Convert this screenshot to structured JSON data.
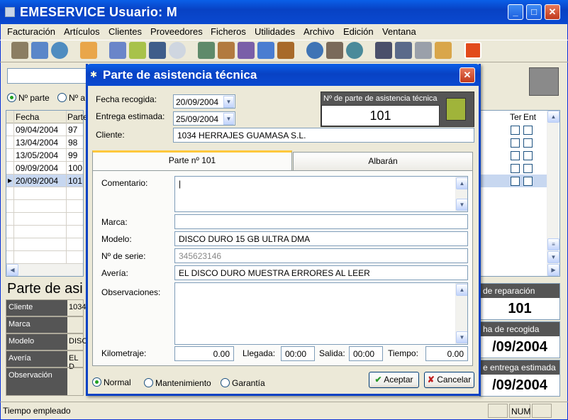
{
  "app": {
    "title": "EMESERVICE Usuario: M"
  },
  "menu": [
    "Facturación",
    "Artículos",
    "Clientes",
    "Proveedores",
    "Ficheros",
    "Utilidades",
    "Archivo",
    "Edición",
    "Ventana"
  ],
  "toolbar_icons": [
    "shelf-icon",
    "globe-icon",
    "globe2-icon",
    "home-icon",
    "users-icon",
    "puzzle-icon",
    "calculator-icon",
    "clock-icon",
    "register-icon",
    "people-icon",
    "people2-icon",
    "network-icon",
    "briefcase-icon",
    "globe3-icon",
    "box-icon",
    "globe4-icon",
    "scanner-icon",
    "book-icon",
    "printer-icon",
    "mail-icon",
    "power-icon"
  ],
  "background": {
    "radio_nparte": "Nº parte",
    "radio_na": "Nº a",
    "grid_headers": [
      "Fecha",
      "Parte"
    ],
    "right_headers": [
      "Ter",
      "Ent"
    ],
    "rows": [
      {
        "fecha": "09/04/2004",
        "parte": "97"
      },
      {
        "fecha": "13/04/2004",
        "parte": "98"
      },
      {
        "fecha": "13/05/2004",
        "parte": "99"
      },
      {
        "fecha": "09/09/2004",
        "parte": "100"
      },
      {
        "fecha": "20/09/2004",
        "parte": "101"
      }
    ],
    "section_title": "Parte de asi",
    "detail_labels": [
      "Cliente",
      "Marca",
      "Modelo",
      "Avería",
      "Observación"
    ],
    "detail_values": [
      "1034",
      "",
      "DISC",
      "EL D",
      ""
    ],
    "right_panels": [
      {
        "label": "de reparación",
        "value": "101"
      },
      {
        "label": "ha de recogida",
        "value": "/09/2004"
      },
      {
        "label": "e entrega estimada",
        "value": "/09/2004"
      }
    ]
  },
  "dialog": {
    "title": "Parte de asistencia técnica",
    "fecha_recogida_label": "Fecha recogida:",
    "fecha_recogida": "20/09/2004",
    "entrega_label": "Entrega estimada:",
    "entrega": "25/09/2004",
    "nparte_label": "Nº de parte de asistencia técnica",
    "nparte": "101",
    "cliente_label": "Cliente:",
    "cliente": "1034 HERRAJES GUAMASA S.L.",
    "tabs": [
      "Parte nº 101",
      "Albarán"
    ],
    "comentario_label": "Comentario:",
    "comentario": "",
    "marca_label": "Marca:",
    "marca": "",
    "modelo_label": "Modelo:",
    "modelo": "DISCO DURO 15 GB ULTRA DMA",
    "serie_label": "Nº de serie:",
    "serie": "345623146",
    "averia_label": "Avería:",
    "averia": "EL DISCO DURO MUESTRA ERRORES AL LEER",
    "observaciones_label": "Observaciones:",
    "observaciones": "",
    "km_label": "Kilometraje:",
    "km": "0.00",
    "llegada_label": "Llegada:",
    "llegada": "00:00",
    "salida_label": "Salida:",
    "salida": "00:00",
    "tiempo_label": "Tiempo:",
    "tiempo": "0.00",
    "radios": [
      "Normal",
      "Mantenimiento",
      "Garantía"
    ],
    "accept": "Aceptar",
    "cancel": "Cancelar"
  },
  "status": {
    "text": "Tiempo empleado",
    "num": "NUM"
  }
}
